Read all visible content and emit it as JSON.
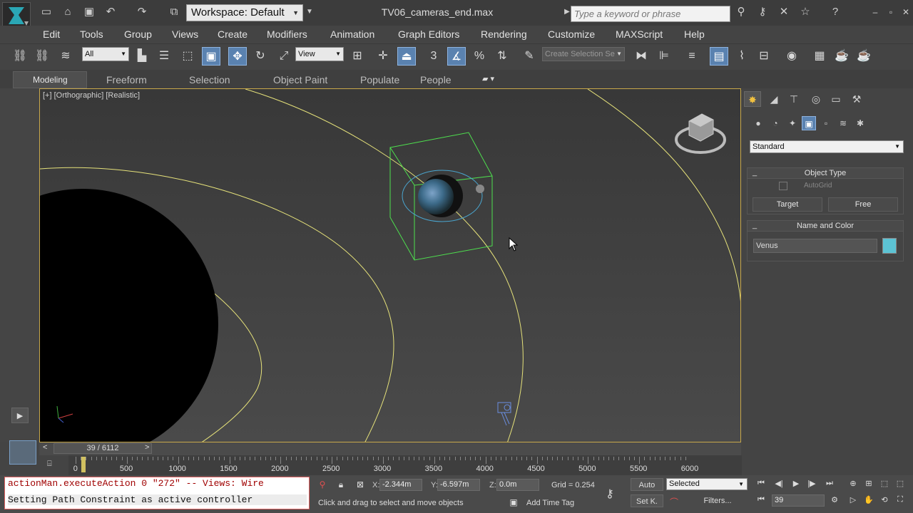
{
  "title_bar": {
    "workspace_label": "Workspace: Default",
    "file_title": "TV06_cameras_end.max",
    "search_placeholder": "Type a keyword or phrase"
  },
  "menu": [
    "Edit",
    "Tools",
    "Group",
    "Views",
    "Create",
    "Modifiers",
    "Animation",
    "Graph Editors",
    "Rendering",
    "Customize",
    "MAXScript",
    "Help"
  ],
  "toolbar": {
    "selection_filter": "All",
    "reference_coord": "View",
    "snap_value": "3",
    "selection_set_placeholder": "Create Selection Se"
  },
  "ribbon_tabs": [
    "Modeling",
    "Freeform",
    "Selection",
    "Object Paint",
    "Populate",
    "People"
  ],
  "viewport": {
    "label": "[+] [Orthographic] [Realistic]"
  },
  "command_panel": {
    "category": "Standard",
    "object_type_title": "Object Type",
    "autogrid_label": "AutoGrid",
    "buttons": [
      "Target",
      "Free"
    ],
    "name_color_title": "Name and Color",
    "object_name": "Venus",
    "object_color": "#5cc3d4",
    "rollout_collapse": "_"
  },
  "timeline": {
    "slider_text": "39 / 6112",
    "prev": "<",
    "next": ">",
    "ticks": [
      "0",
      "500",
      "1000",
      "1500",
      "2000",
      "2500",
      "3000",
      "3500",
      "4000",
      "4500",
      "5000",
      "5500",
      "6000"
    ],
    "current_frame_fraction": 0.0064
  },
  "status": {
    "maxscript_line1": "actionMan.executeAction 0 \"272\"  -- Views: Wire",
    "maxscript_line2": "Setting Path Constraint as active controller",
    "x_label": "X:",
    "x_value": "-2.344m",
    "y_label": "Y:",
    "y_value": "-6.597m",
    "z_label": "Z:",
    "z_value": "0.0m",
    "grid": "Grid = 0.254",
    "hint": "Click and drag to select and move objects",
    "add_time_tag": "Add Time Tag",
    "auto_key": "Auto",
    "set_key": "Set K.",
    "key_filter_selected": "Selected",
    "filters": "Filters...",
    "current_frame": "39"
  }
}
